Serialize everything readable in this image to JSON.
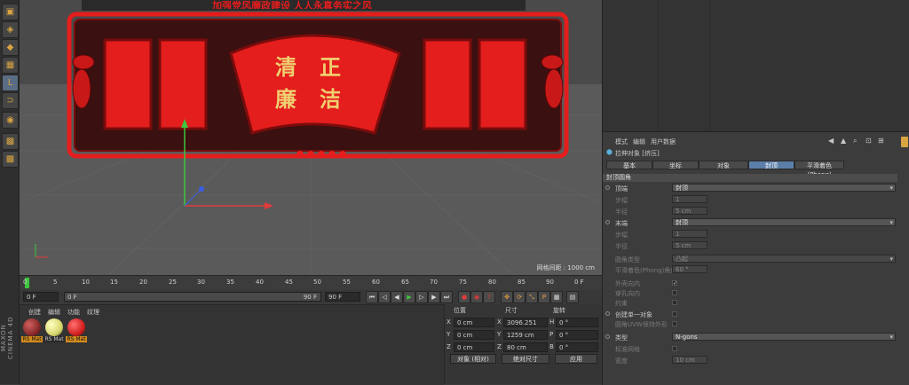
{
  "toolbar": {
    "tools": [
      {
        "icon": "cube-icon"
      },
      {
        "icon": "cube-icon"
      },
      {
        "icon": "cube-icon"
      },
      {
        "icon": "grid-icon"
      },
      {
        "icon": "l-shape-icon"
      },
      {
        "icon": "magnet-icon"
      },
      {
        "icon": "target-icon"
      },
      {
        "icon": "checker-icon"
      },
      {
        "icon": "checker-icon"
      }
    ],
    "logo_top": "MAXON",
    "logo_bottom": "CINEMA 4D"
  },
  "viewport": {
    "banner_text": "加强党风廉政建设 人人永真务实之风",
    "center_text_1": "清",
    "center_text_2": "正",
    "center_text_3": "廉",
    "center_text_4": "洁",
    "grid_distance": "网格间距 : 1000 cm",
    "colors": {
      "red": "#e41d1d",
      "dark_red": "#7a0c0c",
      "gold": "#f0d070",
      "axis_x": "#e33b3b",
      "axis_y": "#3ec63e",
      "axis_z": "#3b5ee3"
    }
  },
  "timeline": {
    "ticks": [
      "0",
      "5",
      "10",
      "15",
      "20",
      "25",
      "30",
      "35",
      "40",
      "45",
      "50",
      "55",
      "60",
      "65",
      "70",
      "75",
      "80",
      "85",
      "90"
    ],
    "end_label": "0 F",
    "start_field": "0 F",
    "range_start": "0 F",
    "range_end": "90 F",
    "end_field": "90 F"
  },
  "material_manager": {
    "menu": [
      "创建",
      "编辑",
      "功能",
      "纹理"
    ],
    "materials": [
      {
        "label": "RS Mat",
        "color": "#8a2a2a",
        "selected": true
      },
      {
        "label": "RS Mat",
        "color": "#d8d870",
        "selected": false
      },
      {
        "label": "RS Mat",
        "color": "#d42020",
        "selected": true
      }
    ]
  },
  "coordinates": {
    "headers": [
      "位置",
      "尺寸",
      "旋转"
    ],
    "rows": [
      {
        "axis": "X",
        "pos": "0 cm",
        "size": "3096.251 cm",
        "rot_axis": "H",
        "rot": "0 °"
      },
      {
        "axis": "Y",
        "pos": "0 cm",
        "size": "1259 cm",
        "rot_axis": "P",
        "rot": "0 °"
      },
      {
        "axis": "Z",
        "pos": "0 cm",
        "size": "80 cm",
        "rot_axis": "B",
        "rot": "0 °"
      }
    ],
    "mode_dropdown": "对象 (相对)",
    "size_dropdown": "绝对尺寸",
    "apply_button": "应用"
  },
  "attributes": {
    "menu": [
      "模式",
      "编辑",
      "用户数据"
    ],
    "object_title": "拉伸对象 [挤压]",
    "tabs": [
      {
        "label": "基本",
        "active": false
      },
      {
        "label": "坐标",
        "active": false
      },
      {
        "label": "对象",
        "active": false
      },
      {
        "label": "封顶",
        "active": true
      },
      {
        "label": "平滑着色(Phong)",
        "active": false
      }
    ],
    "section": "封顶圆角",
    "rows": {
      "top_label": "顶端",
      "top_value": "封顶",
      "step1_label": "步幅",
      "step1_value": "1",
      "radius1_label": "半径",
      "radius1_value": "5 cm",
      "end_label": "末端",
      "end_value": "封顶",
      "step2_label": "步幅",
      "step2_value": "1",
      "radius2_label": "半径",
      "radius2_value": "5 cm",
      "round_type_label": "圆角类型",
      "round_type_value": "凸起",
      "phong_label": "平滑着色(Phong)角度",
      "phong_value": "60 °",
      "outer_label": "外壳向内",
      "hole_label": "穿孔向内",
      "constrain_label": "约束",
      "single_label": "创建单一对象",
      "uvw_label": "圆角UVW保持外形",
      "type_label": "类型",
      "type_value": "N-gons",
      "standard_label": "标准网格",
      "width_label": "宽度",
      "width_value": "10 cm"
    }
  }
}
